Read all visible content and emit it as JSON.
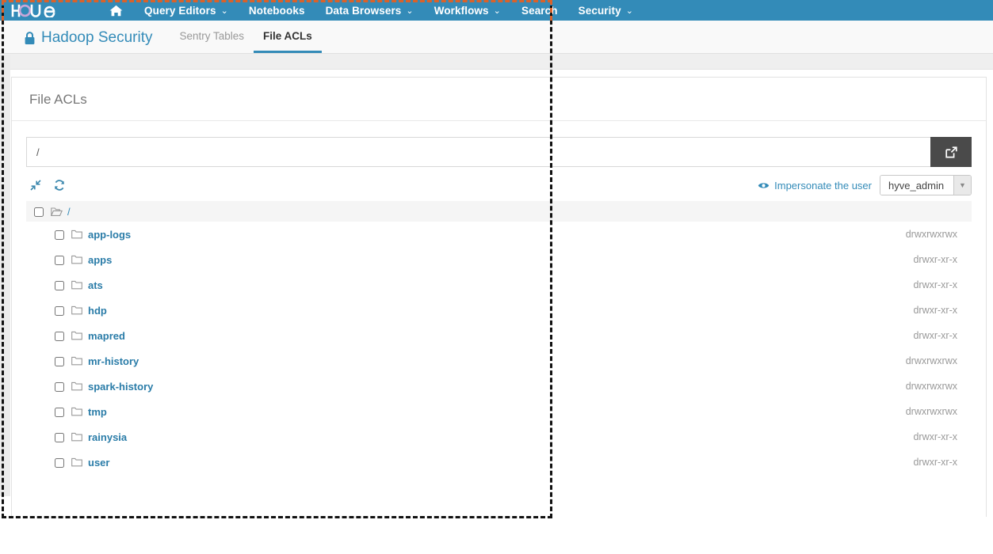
{
  "navbar": {
    "logo_text": "hue",
    "home_icon": "home-icon",
    "items": [
      {
        "label": "Query Editors",
        "caret": "⌄",
        "has_caret": true
      },
      {
        "label": "Notebooks",
        "caret": "",
        "has_caret": false
      },
      {
        "label": "Data Browsers",
        "caret": "⌄",
        "has_caret": true
      },
      {
        "label": "Workflows",
        "caret": "⌄",
        "has_caret": true
      },
      {
        "label": "Search",
        "caret": "",
        "has_caret": false
      },
      {
        "label": "Security",
        "caret": "⌄",
        "has_caret": true
      }
    ],
    "background_color": "#338bb8"
  },
  "subnav": {
    "brand": "Hadoop Security",
    "brand_icon": "lock-icon",
    "brand_color": "#338bb8",
    "tabs": [
      {
        "label": "Sentry Tables",
        "active": false
      },
      {
        "label": "File ACLs",
        "active": true
      }
    ],
    "active_underline_color": "#338bb8"
  },
  "card": {
    "title": "File ACLs"
  },
  "path": {
    "value": "/",
    "placeholder": "/",
    "submit_icon": "external-link-icon",
    "submit_bg": "#4a4a4a"
  },
  "toolbar": {
    "icons": [
      {
        "name": "collapse-arrows-icon"
      },
      {
        "name": "refresh-icon"
      }
    ],
    "impersonate_label": "Impersonate the user",
    "impersonate_icon": "eye-icon",
    "impersonate_color": "#338bb8",
    "user_value": "hyve_admin",
    "user_caret": "▼"
  },
  "file_table": {
    "root_label": "/",
    "root_icon": "folder-open-icon",
    "rows": [
      {
        "name": "app-logs",
        "permissions": "drwxrwxrwx",
        "icon": "folder-icon"
      },
      {
        "name": "apps",
        "permissions": "drwxr-xr-x",
        "icon": "folder-icon"
      },
      {
        "name": "ats",
        "permissions": "drwxr-xr-x",
        "icon": "folder-icon"
      },
      {
        "name": "hdp",
        "permissions": "drwxr-xr-x",
        "icon": "folder-icon"
      },
      {
        "name": "mapred",
        "permissions": "drwxr-xr-x",
        "icon": "folder-icon"
      },
      {
        "name": "mr-history",
        "permissions": "drwxrwxrwx",
        "icon": "folder-icon"
      },
      {
        "name": "spark-history",
        "permissions": "drwxrwxrwx",
        "icon": "folder-icon"
      },
      {
        "name": "tmp",
        "permissions": "drwxrwxrwx",
        "icon": "folder-icon"
      },
      {
        "name": "rainysia",
        "permissions": "drwxr-xr-x",
        "icon": "folder-icon"
      },
      {
        "name": "user",
        "permissions": "drwxr-xr-x",
        "icon": "folder-icon"
      }
    ]
  }
}
